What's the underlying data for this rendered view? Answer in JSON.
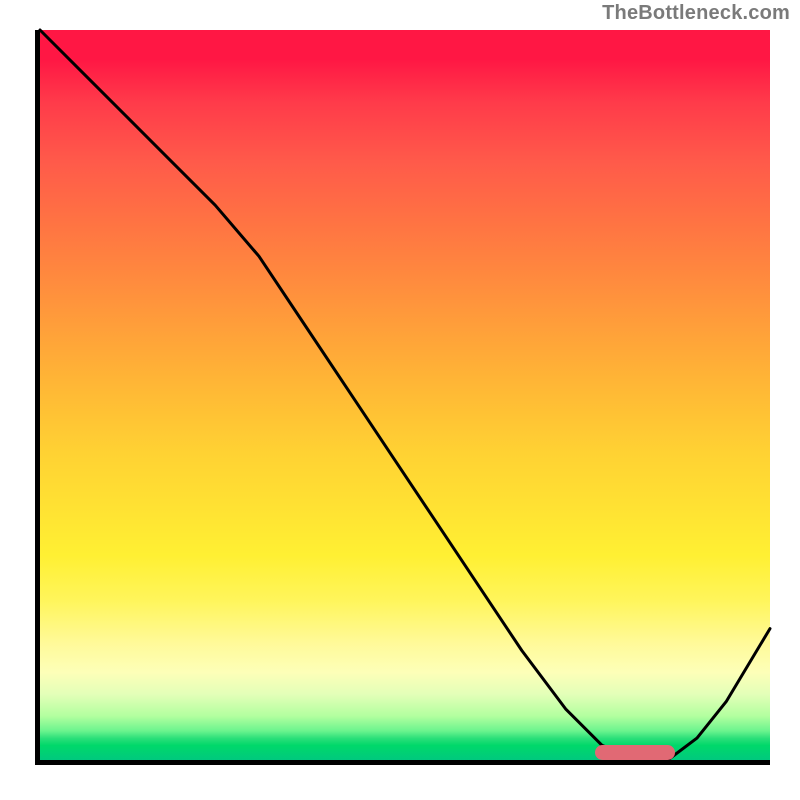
{
  "attribution": "TheBottleneck.com",
  "chart_data": {
    "type": "line",
    "title": "",
    "xlabel": "",
    "ylabel": "",
    "xlim": [
      0,
      100
    ],
    "ylim": [
      0,
      100
    ],
    "x": [
      0,
      6,
      12,
      18,
      24,
      30,
      36,
      42,
      48,
      54,
      60,
      66,
      72,
      77,
      82,
      86,
      90,
      94,
      100
    ],
    "values": [
      100,
      94,
      88,
      82,
      76,
      69,
      60,
      51,
      42,
      33,
      24,
      15,
      7,
      2,
      0,
      0,
      3,
      8,
      18
    ],
    "flat_region": {
      "x_start": 77,
      "x_end": 86,
      "y": 0
    },
    "marker": {
      "x_start": 76,
      "x_end": 87,
      "y": 1,
      "color": "#e16974"
    },
    "gradient_stops": [
      {
        "pct": 0,
        "color": "#ff1744"
      },
      {
        "pct": 50,
        "color": "#ffbb35"
      },
      {
        "pct": 85,
        "color": "#fffa99"
      },
      {
        "pct": 100,
        "color": "#00c97e"
      }
    ]
  }
}
